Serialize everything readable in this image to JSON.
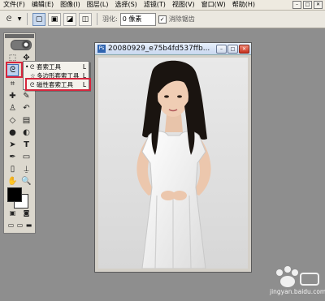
{
  "menu": {
    "items": [
      "文件(F)",
      "编辑(E)",
      "图像(I)",
      "图层(L)",
      "选择(S)",
      "滤镜(T)",
      "视图(V)",
      "窗口(W)",
      "帮助(H)"
    ]
  },
  "options": {
    "feather_label": "羽化:",
    "feather_value": "0 像素",
    "antialias_label": "消除锯齿",
    "antialias_checked": true
  },
  "flyout": {
    "items": [
      {
        "label": "套索工具",
        "shortcut": "L",
        "icon": "lasso-icon",
        "selected": true
      },
      {
        "label": "多边形套索工具",
        "shortcut": "L",
        "icon": "polygonal-lasso-icon",
        "selected": false
      },
      {
        "label": "磁性套索工具",
        "shortcut": "L",
        "icon": "magnetic-lasso-icon",
        "selected": false
      }
    ]
  },
  "document": {
    "title": "20080929_e75b4fd537ffb..."
  },
  "watermark": {
    "site": "jingyan.baidu.com"
  },
  "colors": {
    "highlight": "#d7263d",
    "workspace": "#8e8e8e",
    "foreground": "#000000",
    "background": "#ffffff"
  }
}
